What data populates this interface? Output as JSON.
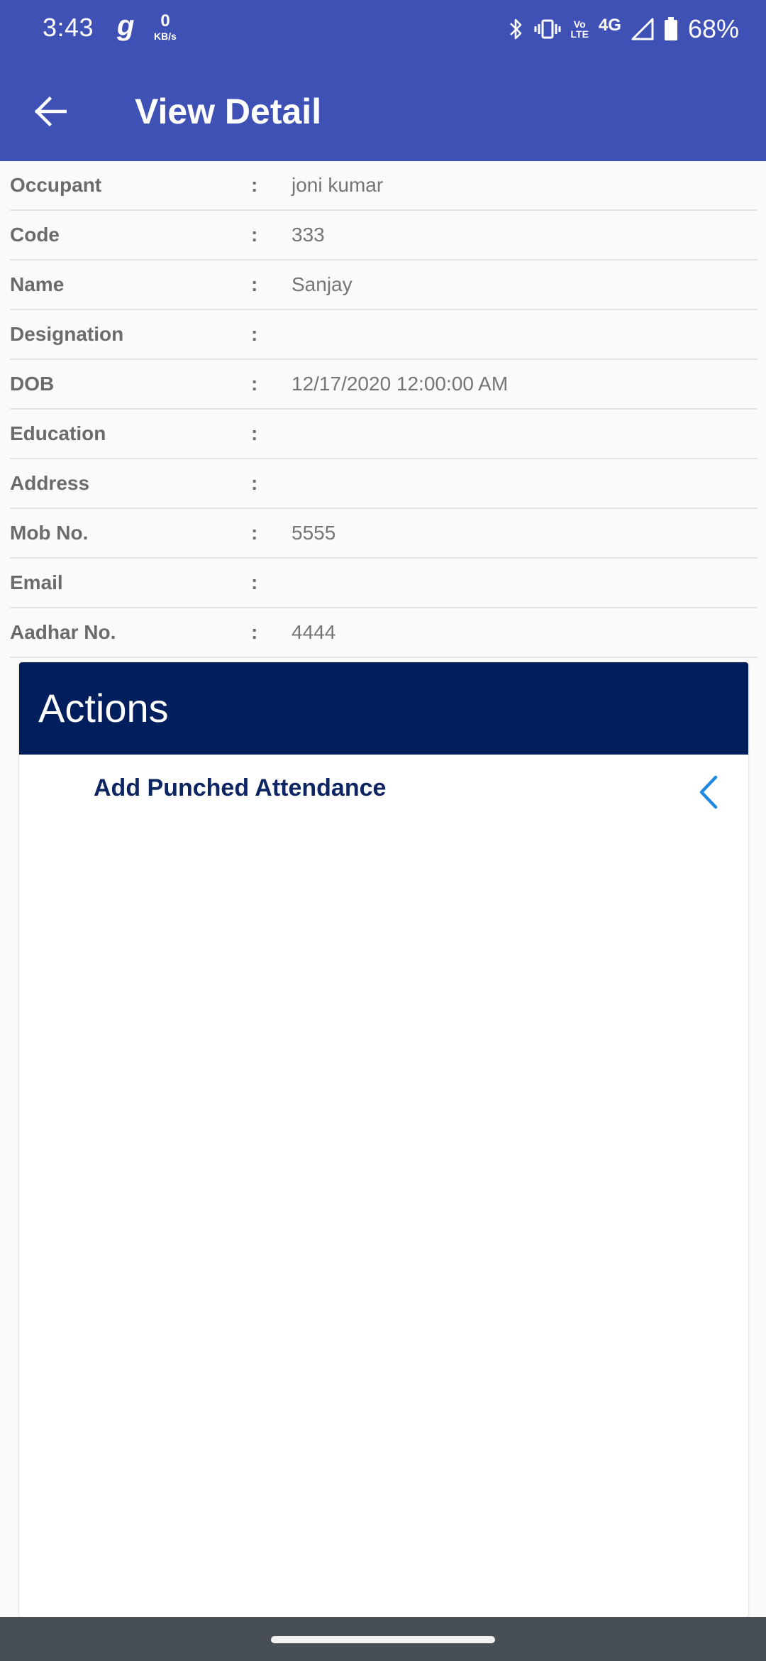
{
  "status_bar": {
    "time": "3:43",
    "g_icon_text": "g",
    "net_speed_value": "0",
    "net_speed_unit": "KB/s",
    "volte_top": "Vo",
    "volte_bottom": "LTE",
    "network": "4G",
    "battery": "68%"
  },
  "app_bar": {
    "title": "View Detail",
    "back_icon": "arrow-left"
  },
  "details": [
    {
      "label": "Occupant",
      "value": "joni kumar"
    },
    {
      "label": "Code",
      "value": "333"
    },
    {
      "label": "Name",
      "value": "Sanjay"
    },
    {
      "label": "Designation",
      "value": ""
    },
    {
      "label": "DOB",
      "value": "12/17/2020 12:00:00 AM"
    },
    {
      "label": "Education",
      "value": ""
    },
    {
      "label": "Address",
      "value": ""
    },
    {
      "label": "Mob No.",
      "value": "5555"
    },
    {
      "label": "Email",
      "value": ""
    },
    {
      "label": "Aadhar No.",
      "value": "4444"
    }
  ],
  "separator": ":",
  "actions": {
    "title": "Actions",
    "items": [
      {
        "label": "Add Punched Attendance",
        "icon": "chevron-left"
      }
    ]
  },
  "colors": {
    "app_bar": "#3f51b5",
    "actions_header": "#001f5c",
    "action_text": "#0d2563",
    "chevron": "#1e88e5",
    "nav_bar": "#474f55"
  }
}
